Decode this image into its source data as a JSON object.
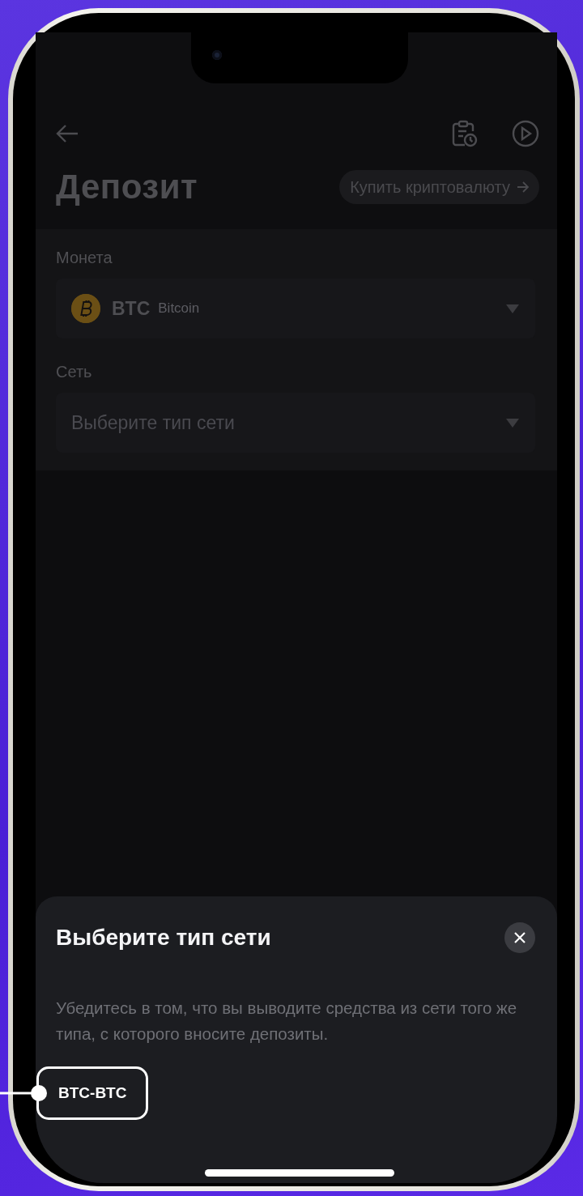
{
  "header": {
    "title": "Депозит",
    "buy_button": "Купить криптовалюту"
  },
  "coin": {
    "label": "Монета",
    "symbol": "BTC",
    "name": "Bitcoin"
  },
  "network": {
    "label": "Сеть",
    "placeholder": "Выберите тип сети"
  },
  "sheet": {
    "title": "Выберите тип сети",
    "description": "Убедитесь в том, что вы выводите средства из сети того же типа, с которого вносите депозиты.",
    "options": [
      {
        "label": "BTC-BTC",
        "highlighted": true
      }
    ]
  }
}
